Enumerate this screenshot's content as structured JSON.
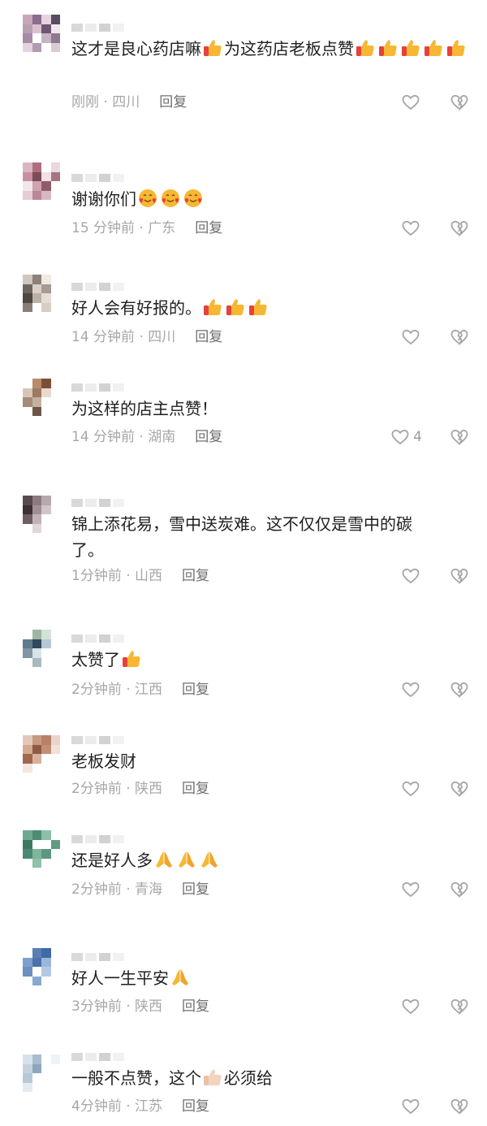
{
  "icons": {
    "thumb": "thumbs-up-emoji",
    "smile": "smiling-face-with-hearts-emoji",
    "pray": "folded-hands-emoji",
    "thumb_light": "thumbs-up-light-emoji",
    "like": "heart-outline-icon",
    "dislike": "broken-heart-icon"
  },
  "colors": {
    "text": "#1f1f1f",
    "meta": "#a7a7a7",
    "reply": "#6f6f6f",
    "emoji_yellow": "#f7b733",
    "emoji_red": "#e8403a"
  },
  "comments": [
    {
      "text_segments": [
        "这才是良心药店嘛",
        "thumb",
        "为这药店老板点赞",
        "thumb",
        "thumb",
        "thumb",
        "thumb",
        "thumb"
      ],
      "time": "刚刚",
      "location": "四川",
      "reply": "回复",
      "likes": ""
    },
    {
      "text_segments": [
        "谢谢你们",
        "smile",
        "smile",
        "smile"
      ],
      "time": "15 分钟前",
      "location": "广东",
      "reply": "回复",
      "likes": ""
    },
    {
      "text_segments": [
        "好人会有好报的。",
        "thumb",
        "thumb",
        "thumb"
      ],
      "time": "14 分钟前",
      "location": "四川",
      "reply": "回复",
      "likes": ""
    },
    {
      "text_segments": [
        "为这样的店主点赞！"
      ],
      "time": "14 分钟前",
      "location": "湖南",
      "reply": "回复",
      "likes": "4"
    },
    {
      "text_segments": [
        "锦上添花易，雪中送炭难。这不仅仅是雪中的碳\n了。"
      ],
      "time": "1分钟前",
      "location": "山西",
      "reply": "回复",
      "likes": ""
    },
    {
      "text_segments": [
        "太赞了",
        "thumb"
      ],
      "time": "2分钟前",
      "location": "江西",
      "reply": "回复",
      "likes": ""
    },
    {
      "text_segments": [
        "老板发财"
      ],
      "time": "2分钟前",
      "location": "陕西",
      "reply": "回复",
      "likes": ""
    },
    {
      "text_segments": [
        "还是好人多",
        "pray",
        "pray",
        "pray"
      ],
      "time": "2分钟前",
      "location": "青海",
      "reply": "回复",
      "likes": ""
    },
    {
      "text_segments": [
        "好人一生平安",
        "pray"
      ],
      "time": "3分钟前",
      "location": "陕西",
      "reply": "回复",
      "likes": ""
    },
    {
      "text_segments": [
        "一般不点赞，这个",
        "thumb_light",
        "必须给"
      ],
      "time": "4分钟前",
      "location": "江苏",
      "reply": "回复",
      "likes": ""
    }
  ]
}
